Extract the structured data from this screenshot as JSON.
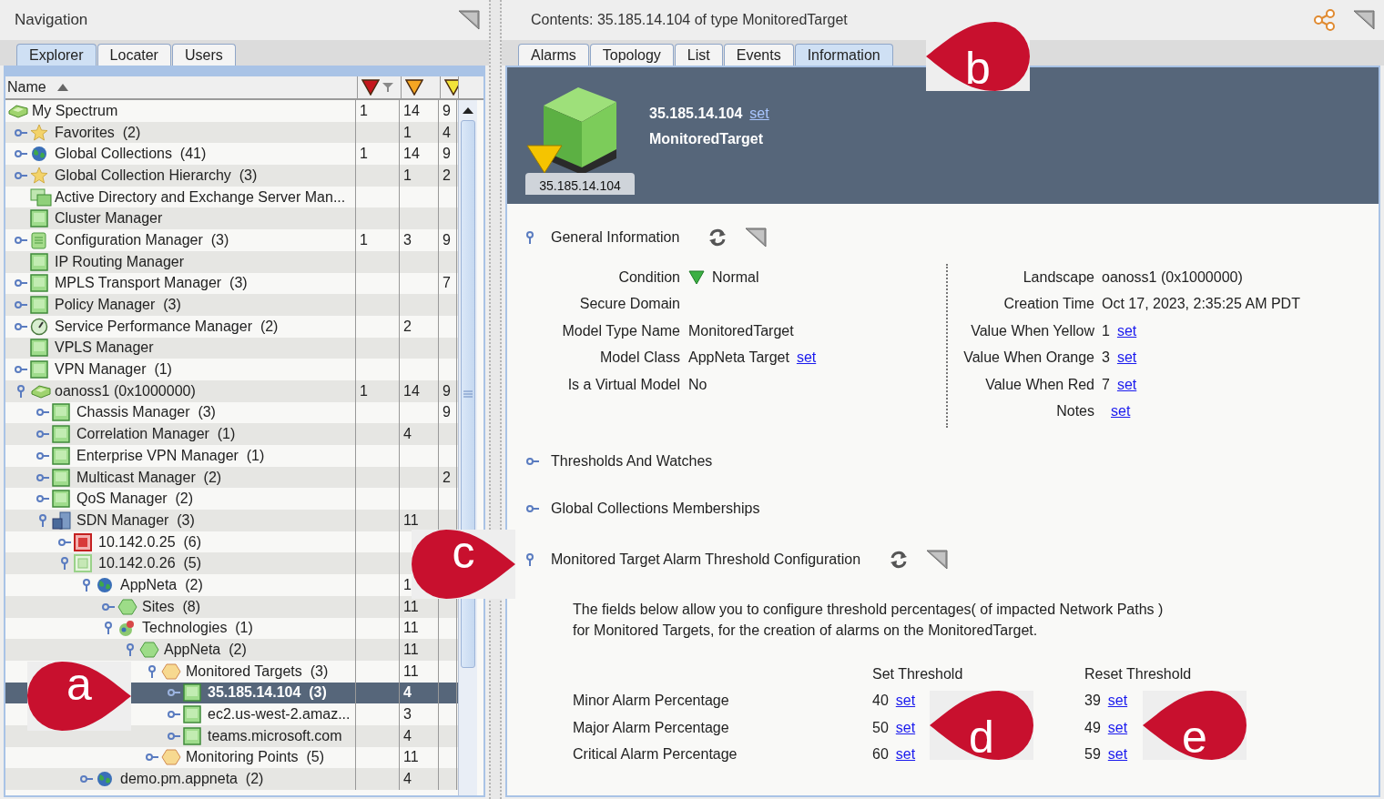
{
  "navigation": {
    "title": "Navigation",
    "tabs": [
      {
        "label": "Explorer",
        "selected": true
      },
      {
        "label": "Locater",
        "selected": false
      },
      {
        "label": "Users",
        "selected": false
      }
    ],
    "tree": {
      "name_column": {
        "label": "Name"
      },
      "alarm_columns": [
        {
          "color": "#c4161c",
          "filtered": true
        },
        {
          "color": "#f5a623",
          "filtered": false
        },
        {
          "color": "#f2e33a",
          "filtered": false
        }
      ],
      "rows": [
        {
          "label": "My Spectrum",
          "kind": "spectrum",
          "selected": false,
          "column_2": "1",
          "column_3": "14",
          "column_4": "9",
          "children": [
            {
              "label": "Favorites  (2)",
              "kind": "star",
              "expanded": false,
              "selected": false,
              "column_3": "1",
              "column_4": "4"
            },
            {
              "label": "Global Collections  (41)",
              "kind": "globe",
              "expanded": false,
              "selected": false,
              "column_2": "1",
              "column_3": "14",
              "column_4": "9"
            },
            {
              "label": "Global Collection Hierarchy  (3)",
              "kind": "star",
              "expanded": false,
              "selected": false,
              "column_3": "1",
              "column_4": "2"
            },
            {
              "label": "Active Directory and Exchange Server Man...",
              "kind": "servers",
              "selected": false
            },
            {
              "label": "Cluster Manager",
              "kind": "square",
              "selected": false
            },
            {
              "label": "Configuration Manager  (3)",
              "kind": "config",
              "expanded": false,
              "selected": false,
              "column_2": "1",
              "column_3": "3",
              "column_4": "9"
            },
            {
              "label": "IP Routing Manager",
              "kind": "square",
              "selected": false
            },
            {
              "label": "MPLS Transport Manager  (3)",
              "kind": "square",
              "expanded": false,
              "selected": false,
              "column_4": "7"
            },
            {
              "label": "Policy Manager  (3)",
              "kind": "square",
              "expanded": false,
              "selected": false
            },
            {
              "label": "Service Performance Manager  (2)",
              "kind": "gauge",
              "expanded": false,
              "selected": false,
              "column_3": "2"
            },
            {
              "label": "VPLS Manager",
              "kind": "square",
              "selected": false
            },
            {
              "label": "VPN Manager  (1)",
              "kind": "square",
              "expanded": false,
              "selected": false
            },
            {
              "label": "oanoss1 (0x1000000)",
              "kind": "spectrum",
              "expanded": true,
              "selected": false,
              "column_2": "1",
              "column_3": "14",
              "column_4": "9",
              "children": [
                {
                  "label": "Chassis Manager  (3)",
                  "kind": "square",
                  "expanded": false,
                  "selected": false,
                  "column_4": "9"
                },
                {
                  "label": "Correlation Manager  (1)",
                  "kind": "square",
                  "expanded": false,
                  "selected": false,
                  "column_3": "4"
                },
                {
                  "label": "Enterprise VPN Manager  (1)",
                  "kind": "square",
                  "expanded": false,
                  "selected": false
                },
                {
                  "label": "Multicast Manager  (2)",
                  "kind": "square",
                  "expanded": false,
                  "selected": false,
                  "column_4": "2"
                },
                {
                  "label": "QoS Manager  (2)",
                  "kind": "square",
                  "expanded": false,
                  "selected": false
                },
                {
                  "label": "SDN Manager  (3)",
                  "kind": "sdn",
                  "expanded": true,
                  "selected": false,
                  "column_3": "11",
                  "children": [
                    {
                      "label": "10.142.0.25  (6)",
                      "kind": "square-red",
                      "expanded": false,
                      "selected": false
                    },
                    {
                      "label": "10.142.0.26  (5)",
                      "kind": "square-outline",
                      "expanded": true,
                      "selected": false,
                      "children": [
                        {
                          "label": "AppNeta  (2)",
                          "kind": "globe",
                          "expanded": true,
                          "selected": false,
                          "column_3": "1",
                          "children": [
                            {
                              "label": "Sites  (8)",
                              "kind": "hexagon-green",
                              "expanded": false,
                              "selected": false,
                              "column_3": "11"
                            },
                            {
                              "label": "Technologies  (1)",
                              "kind": "tech",
                              "expanded": true,
                              "selected": false,
                              "column_3": "11",
                              "children": [
                                {
                                  "label": "AppNeta  (2)",
                                  "kind": "hexagon-green",
                                  "expanded": true,
                                  "selected": false,
                                  "column_3": "11",
                                  "children": [
                                    {
                                      "label": "Monitored Targets  (3)",
                                      "kind": "hexagon-orange",
                                      "expanded": true,
                                      "selected": false,
                                      "column_3": "11",
                                      "children": [
                                        {
                                          "label": "35.185.14.104  (3)",
                                          "kind": "square",
                                          "expanded": false,
                                          "selected": true,
                                          "column_3": "4"
                                        },
                                        {
                                          "label": "ec2.us-west-2.amaz...",
                                          "kind": "square",
                                          "expanded": false,
                                          "selected": false,
                                          "column_3": "3"
                                        },
                                        {
                                          "label": "teams.microsoft.com",
                                          "kind": "square",
                                          "expanded": false,
                                          "selected": false,
                                          "column_3": "4"
                                        }
                                      ]
                                    },
                                    {
                                      "label": "Monitoring Points  (5)",
                                      "kind": "hexagon-orange",
                                      "expanded": false,
                                      "selected": false,
                                      "column_3": "11"
                                    }
                                  ]
                                }
                              ]
                            }
                          ]
                        },
                        {
                          "label": "demo.pm.appneta  (2)",
                          "kind": "globe",
                          "expanded": false,
                          "selected": false,
                          "column_3": "4"
                        }
                      ]
                    }
                  ]
                }
              ]
            }
          ]
        }
      ]
    }
  },
  "contents": {
    "title": "Contents: 35.185.14.104 of type MonitoredTarget",
    "tabs": [
      {
        "label": "Alarms",
        "selected": false
      },
      {
        "label": "Topology",
        "selected": false
      },
      {
        "label": "List",
        "selected": false
      },
      {
        "label": "Events",
        "selected": false
      },
      {
        "label": "Information",
        "selected": true
      }
    ],
    "banner": {
      "icon_label": "35.185.14.104",
      "name": "35.185.14.104",
      "name_link": "set",
      "type": "MonitoredTarget"
    },
    "sections": [
      {
        "title": "General Information",
        "kind": "fields",
        "expanded": true,
        "left": [
          {
            "label": "Condition",
            "value": "Normal",
            "kind": "condition"
          },
          {
            "label": "Secure Domain"
          },
          {
            "label": "Model Type Name",
            "value": "MonitoredTarget"
          },
          {
            "label": "Model Class",
            "value": "AppNeta Target",
            "link": "set"
          },
          {
            "label": "Is a Virtual Model",
            "value": "No"
          }
        ],
        "right": [
          {
            "label": "Landscape",
            "value": "oanoss1 (0x1000000)"
          },
          {
            "label": "Creation Time",
            "value": "Oct 17, 2023, 2:35:25 AM PDT"
          },
          {
            "label": "Value When Yellow",
            "value": "1",
            "link": "set"
          },
          {
            "label": "Value When Orange",
            "value": "3",
            "link": "set"
          },
          {
            "label": "Value When Red",
            "value": "7",
            "link": "set"
          },
          {
            "label": "Notes",
            "link": "set"
          }
        ]
      },
      {
        "title": "Thresholds And Watches",
        "kind": "plain",
        "expanded": false
      },
      {
        "title": "Global Collections Memberships",
        "kind": "plain",
        "expanded": false
      },
      {
        "title": "Monitored Target Alarm Threshold Configuration",
        "kind": "thresholds",
        "expanded": true,
        "intro": [
          "The fields below allow you to configure threshold percentages( of impacted Network Paths )",
          "for Monitored Targets, for the creation of alarms on the MonitoredTarget."
        ],
        "columns": [
          "Set Threshold",
          "Reset Threshold"
        ],
        "rows": [
          {
            "label": "Minor Alarm Percentage",
            "set_value": "40",
            "set_link": "set",
            "reset_value": "39",
            "reset_link": "set"
          },
          {
            "label": "Major Alarm Percentage",
            "set_value": "50",
            "set_link": "set",
            "reset_value": "49",
            "reset_link": "set"
          },
          {
            "label": "Critical Alarm Percentage",
            "set_value": "60",
            "set_link": "set",
            "reset_value": "59",
            "reset_link": "set"
          }
        ]
      }
    ]
  },
  "callouts": [
    {
      "letter": "a"
    },
    {
      "letter": "b"
    },
    {
      "letter": "c"
    },
    {
      "letter": "d"
    },
    {
      "letter": "e"
    }
  ]
}
